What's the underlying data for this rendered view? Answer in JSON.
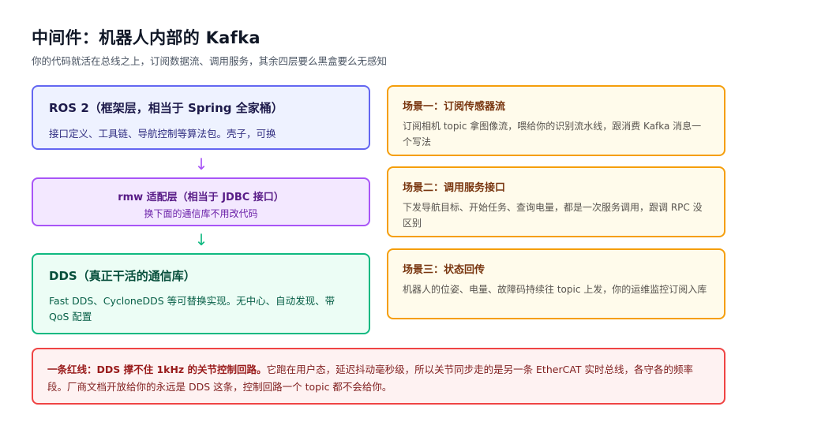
{
  "header": {
    "title": "中间件：机器人内部的 Kafka",
    "subtitle": "你的代码就活在总线之上，订阅数据流、调用服务，其余四层要么黑盒要么无感知"
  },
  "layers": {
    "ros": {
      "title": "ROS 2（框架层，相当于 Spring 全家桶）",
      "desc": "接口定义、工具链、导航控制等算法包。壳子，可换"
    },
    "rmw": {
      "title": "rmw 适配层（相当于 JDBC 接口）",
      "desc": "换下面的通信库不用改代码"
    },
    "dds": {
      "title": "DDS（真正干活的通信库）",
      "desc": "Fast DDS、CycloneDDS 等可替换实现。无中心、自动发现、带 QoS 配置"
    },
    "arrow_glyph": "↓"
  },
  "scenes": [
    {
      "title": "场景一：订阅传感器流",
      "desc": "订阅相机 topic 拿图像流，喂给你的识别流水线，跟消费 Kafka 消息一个写法"
    },
    {
      "title": "场景二：调用服务接口",
      "desc": "下发导航目标、开始任务、查询电量，都是一次服务调用，跟调 RPC 没区别"
    },
    {
      "title": "场景三：状态回传",
      "desc": "机器人的位姿、电量、故障码持续往 topic 上发，你的运维监控订阅入库"
    }
  ],
  "warning": {
    "strong": "一条红线：DDS 撑不住 1kHz 的关节控制回路。",
    "text": "它跑在用户态，延迟抖动毫秒级，所以关节同步走的是另一条 EtherCAT 实时总线，各守各的频率段。厂商文档开放给你的永远是 DDS 这条，控制回路一个 topic 都不会给你。"
  },
  "colors": {
    "ros_border": "#6366f1",
    "rmw_border": "#a855f7",
    "dds_border": "#10b981",
    "scene_border": "#f59e0b",
    "warning_border": "#ef4444"
  }
}
